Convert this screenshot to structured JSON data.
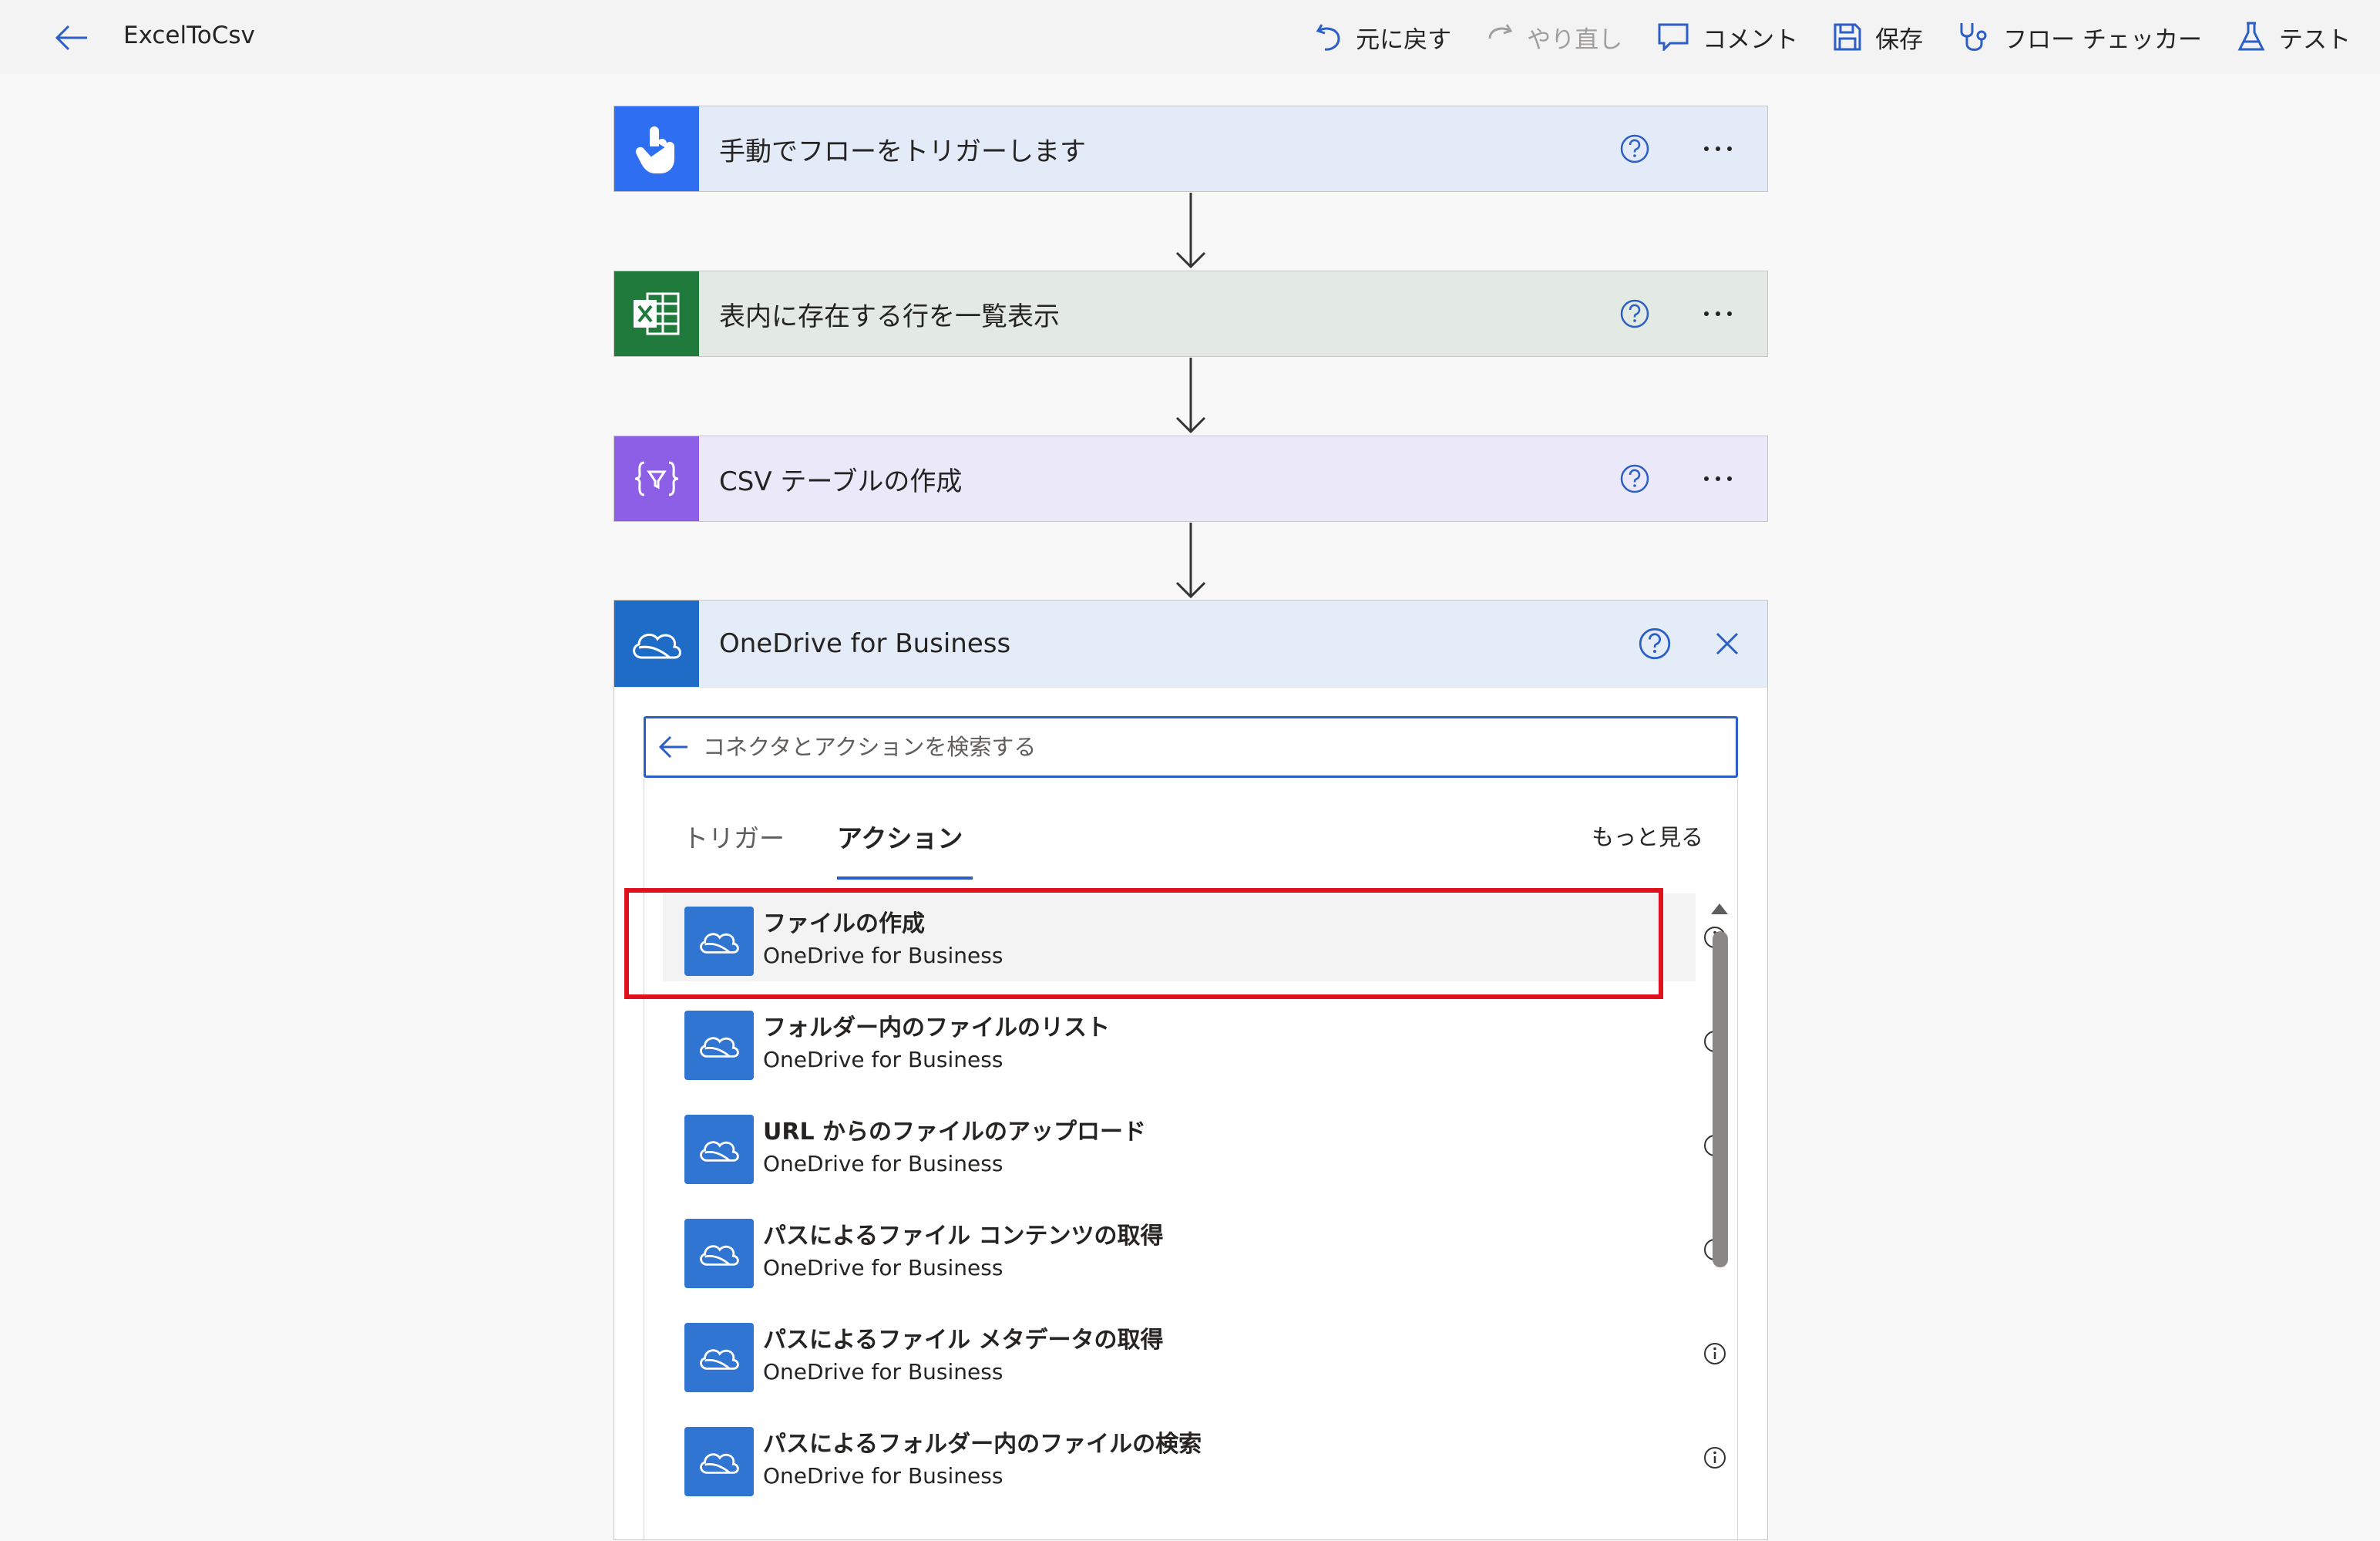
{
  "app": {
    "title": "ExcelToCsv"
  },
  "toolbar": {
    "undo": "元に戻す",
    "redo": "やり直し",
    "comment": "コメント",
    "save": "保存",
    "flow_checker": "フロー チェッカー",
    "test": "テスト"
  },
  "flow": {
    "steps": [
      {
        "label": "手動でフローをトリガーします",
        "icon": "touch-icon",
        "color": "#2e6ef0",
        "bg": "#e3eaf8"
      },
      {
        "label": "表内に存在する行を一覧表示",
        "icon": "excel-icon",
        "color": "#1f7a3c",
        "bg": "#e2eae3"
      },
      {
        "label": "CSV テーブルの作成",
        "icon": "data-operation-icon",
        "color": "#8c5fe6",
        "bg": "#ebe8f9"
      }
    ],
    "connector_panel": {
      "title": "OneDrive for Business",
      "search_placeholder": "コネクタとアクションを検索する",
      "tabs": [
        {
          "label": "トリガー",
          "active": false
        },
        {
          "label": "アクション",
          "active": true
        }
      ],
      "more_label": "もっと見る",
      "actions": [
        {
          "title": "ファイルの作成",
          "subtitle": "OneDrive for Business",
          "highlighted": true
        },
        {
          "title": "フォルダー内のファイルのリスト",
          "subtitle": "OneDrive for Business",
          "highlighted": false
        },
        {
          "title": "URL からのファイルのアップロード",
          "subtitle": "OneDrive for Business",
          "highlighted": false
        },
        {
          "title": "パスによるファイル コンテンツの取得",
          "subtitle": "OneDrive for Business",
          "highlighted": false
        },
        {
          "title": "パスによるファイル メタデータの取得",
          "subtitle": "OneDrive for Business",
          "highlighted": false
        },
        {
          "title": "パスによるフォルダー内のファイルの検索",
          "subtitle": "OneDrive for Business",
          "highlighted": false
        }
      ]
    }
  },
  "colors": {
    "accent": "#2b5fc7",
    "onedrive": "#1f6cc6",
    "highlight_border": "#e0111d"
  }
}
